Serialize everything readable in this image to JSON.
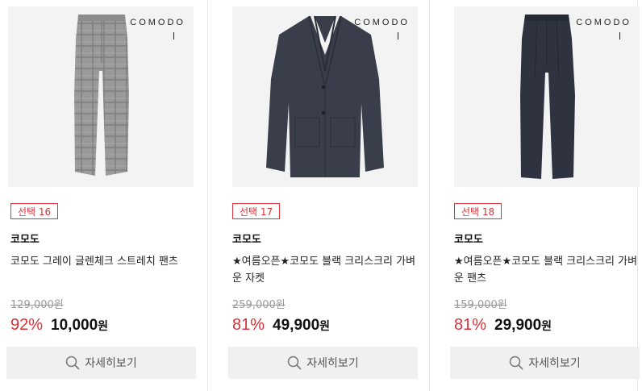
{
  "products": [
    {
      "logo": "COMODO",
      "badge": "선택 16",
      "brand": "코모도",
      "title": "코모도 그레이 글렌체크 스트레치 팬츠",
      "original_price": "129,000원",
      "discount": "92%",
      "price": "10,000",
      "currency": "원",
      "button_label": "자세히보기",
      "image_icon": "gray-check-pants-photo"
    },
    {
      "logo": "COMODO",
      "badge": "선택 17",
      "brand": "코모도",
      "title": "★여름오픈★코모도 블랙 크리스크리 가벼운 자켓",
      "original_price": "259,000원",
      "discount": "81%",
      "price": "49,900",
      "currency": "원",
      "button_label": "자세히보기",
      "image_icon": "black-jacket-photo"
    },
    {
      "logo": "COMODO",
      "badge": "선택 18",
      "brand": "코모도",
      "title": "★여름오픈★코모도 블랙 크리스크리 가벼운 팬츠",
      "original_price": "159,000원",
      "discount": "81%",
      "price": "29,900",
      "currency": "원",
      "button_label": "자세히보기",
      "image_icon": "black-pants-photo"
    }
  ],
  "colors": {
    "accent": "#d9323a",
    "button_bg": "#f0f0f0",
    "image_bg": "#f3f3f3"
  }
}
